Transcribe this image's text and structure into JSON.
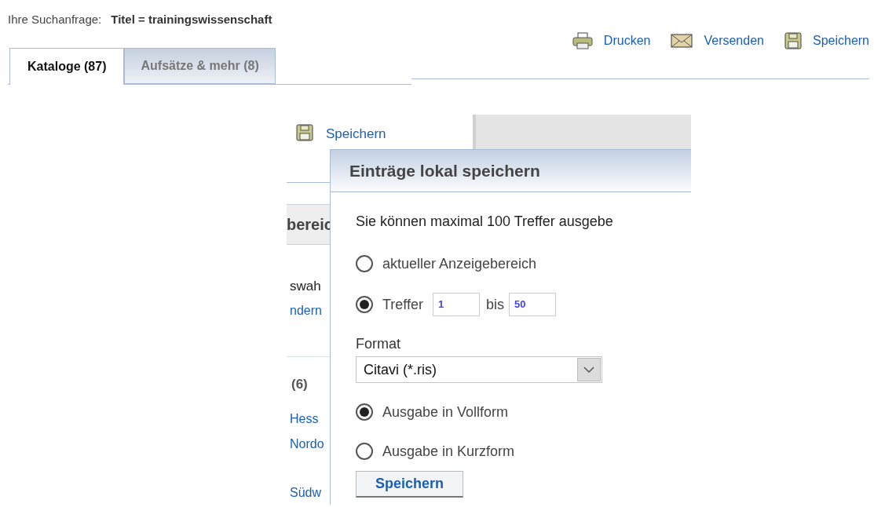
{
  "query": {
    "label": "Ihre Suchanfrage:",
    "value": "Titel = trainingswissenschaft"
  },
  "tabs": [
    {
      "label": "Kataloge (87)",
      "selected": true
    },
    {
      "label": "Aufsätze & mehr (8)",
      "selected": false
    }
  ],
  "actions": [
    {
      "kind": "print",
      "label": "Drucken"
    },
    {
      "kind": "mail",
      "label": "Versenden"
    },
    {
      "kind": "save",
      "label": "Speichern"
    }
  ],
  "detail": {
    "save_link": "Speichern",
    "background": [
      {
        "kind": "heading",
        "text": "bereic"
      },
      {
        "kind": "text",
        "text": "swah"
      },
      {
        "kind": "link",
        "text": "ndern"
      },
      {
        "kind": "count",
        "text": "(6)"
      },
      {
        "kind": "link",
        "text": "Hess"
      },
      {
        "kind": "link",
        "text": "Nordo"
      },
      {
        "kind": "link",
        "text": "Südw"
      }
    ],
    "dialog": {
      "title": "Einträge lokal speichern",
      "intro": "Sie können maximal 100 Treffer ausgebe",
      "range_options": [
        {
          "kind": "plain",
          "label": "aktueller Anzeigebereich",
          "selected": false
        },
        {
          "kind": "range",
          "label": "Treffer",
          "from": "1",
          "to_label": "bis",
          "to": "50",
          "selected": true
        }
      ],
      "format_label": "Format",
      "format_value": "Citavi (*.ris)",
      "output_options": [
        {
          "label": "Ausgabe in Vollform",
          "selected": true
        },
        {
          "label": "Ausgabe in Kurzform",
          "selected": false
        }
      ],
      "button": "Speichern"
    }
  }
}
